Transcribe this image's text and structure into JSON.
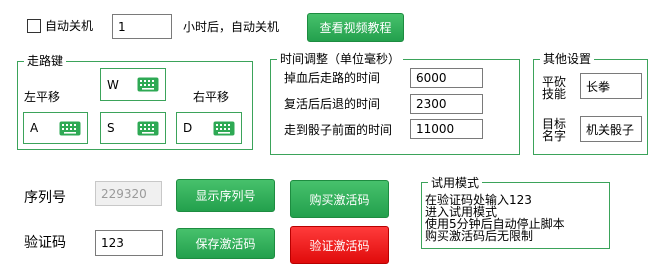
{
  "auto_shutdown": {
    "checkbox_label": "自动关机",
    "hours_value": "1",
    "hours_suffix": "小时后，自动关机",
    "tutorial_button": "查看视频教程"
  },
  "walk_keys": {
    "title": "走路键",
    "left_label": "左平移",
    "right_label": "右平移",
    "up_key": "W",
    "left_key": "A",
    "down_key": "S",
    "right_key": "D"
  },
  "timing": {
    "title": "时间调整（单位毫秒）",
    "rows": [
      {
        "label": "掉血后走路的时间",
        "value": "6000"
      },
      {
        "label": "复活后后退的时间",
        "value": "2300"
      },
      {
        "label": "走到骰子前面的时间",
        "value": "11000"
      }
    ]
  },
  "other": {
    "title": "其他设置",
    "skill_label_line1": "平砍",
    "skill_label_line2": "技能",
    "skill_value": "长拳",
    "target_label_line1": "目标",
    "target_label_line2": "名字",
    "target_value": "机关骰子"
  },
  "activation": {
    "serial_label": "序列号",
    "serial_value": "229320",
    "show_serial_button": "显示序列号",
    "buy_code_button": "购买激活码",
    "code_label": "验证码",
    "code_value": "123",
    "save_code_button": "保存激活码",
    "verify_button": "验证激活码"
  },
  "trial": {
    "title": "试用模式",
    "lines": [
      "在验证码处输入123",
      "进入试用模式",
      "使用5分钟后自动停止脚本",
      "购买激活码后无限制"
    ]
  },
  "colors": {
    "accent_green": "#2ea954",
    "border_green": "#3ba35a",
    "danger_red": "#f01818"
  }
}
